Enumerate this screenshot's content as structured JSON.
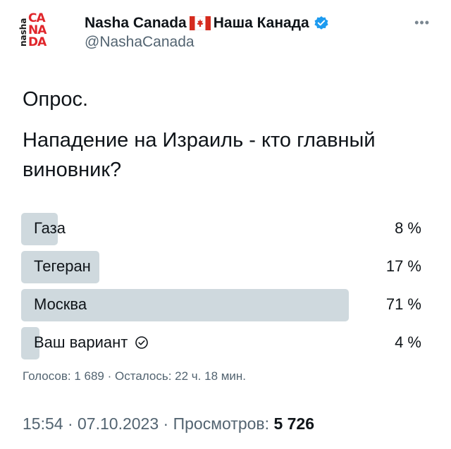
{
  "author": {
    "display_name_en": "Nasha Canada",
    "display_name_ru": "Наша Канада",
    "handle": "@NashaCanada",
    "logo_side_text": "nasha",
    "logo_lines": [
      "CA",
      "NA",
      "DA"
    ]
  },
  "tweet": {
    "line1": "Опрос.",
    "line2": "Нападение на Израиль - кто главный виновник?"
  },
  "poll": {
    "options": [
      {
        "label": "Газа",
        "percent_text": "8 %",
        "percent": 8
      },
      {
        "label": "Тегеран",
        "percent_text": "17 %",
        "percent": 17
      },
      {
        "label": "Москва",
        "percent_text": "71 %",
        "percent": 71
      },
      {
        "label": "Ваш вариант",
        "percent_text": "4 %",
        "percent": 4,
        "selected": true
      }
    ],
    "votes_text": "Голосов: 1 689",
    "remaining_text": "Осталось: 22 ч. 18 мин.",
    "separator": "·"
  },
  "meta": {
    "time": "15:54",
    "date": "07.10.2023",
    "views_label": "Просмотров:",
    "views_count": "5 726",
    "separator": "·"
  },
  "colors": {
    "bar": "#cfd9de",
    "verified": "#1d9bf0",
    "logo_red": "#e0262b",
    "muted": "#536471"
  },
  "icons": [
    "canada-flag-icon",
    "verified-badge-icon",
    "more-icon",
    "check-circle-icon"
  ]
}
